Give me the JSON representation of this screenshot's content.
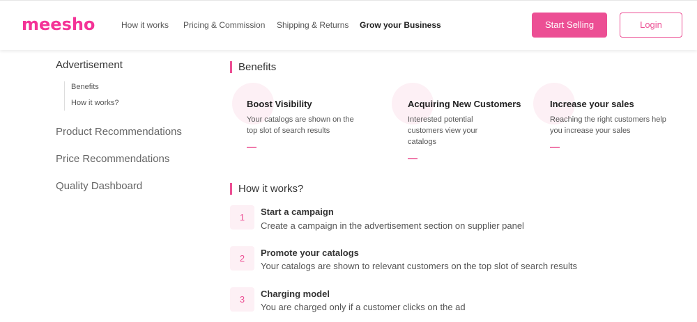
{
  "header": {
    "logo": "meesho",
    "nav": [
      "How it works",
      "Pricing & Commission",
      "Shipping & Returns",
      "Grow your Business"
    ],
    "start_selling": "Start Selling",
    "login": "Login"
  },
  "sidebar": {
    "active": "Advertisement",
    "subitems": [
      "Benefits",
      "How it works?"
    ],
    "items": [
      "Product Recommendations",
      "Price Recommendations",
      "Quality Dashboard"
    ]
  },
  "benefits": {
    "title": "Benefits",
    "cards": [
      {
        "title": "Boost Visibility",
        "desc": "Your catalogs are shown on the top slot of search results"
      },
      {
        "title": "Acquiring New Customers",
        "desc": "Interested potential customers view your catalogs"
      },
      {
        "title": "Increase your sales",
        "desc": "Reaching the right customers help you increase your sales"
      }
    ]
  },
  "how_it_works": {
    "title": "How it works?",
    "steps": [
      {
        "num": "1",
        "title": "Start a campaign",
        "desc": "Create a campaign in the advertisement section on supplier panel"
      },
      {
        "num": "2",
        "title": "Promote your catalogs",
        "desc": "Your catalogs are shown to relevant customers on the top slot of search results"
      },
      {
        "num": "3",
        "title": "Charging model",
        "desc": "You are charged only if a customer clicks on the ad"
      }
    ]
  },
  "colors": {
    "brand": "#f43397",
    "accent": "#ec4f94",
    "tint": "#fdf0f5"
  }
}
